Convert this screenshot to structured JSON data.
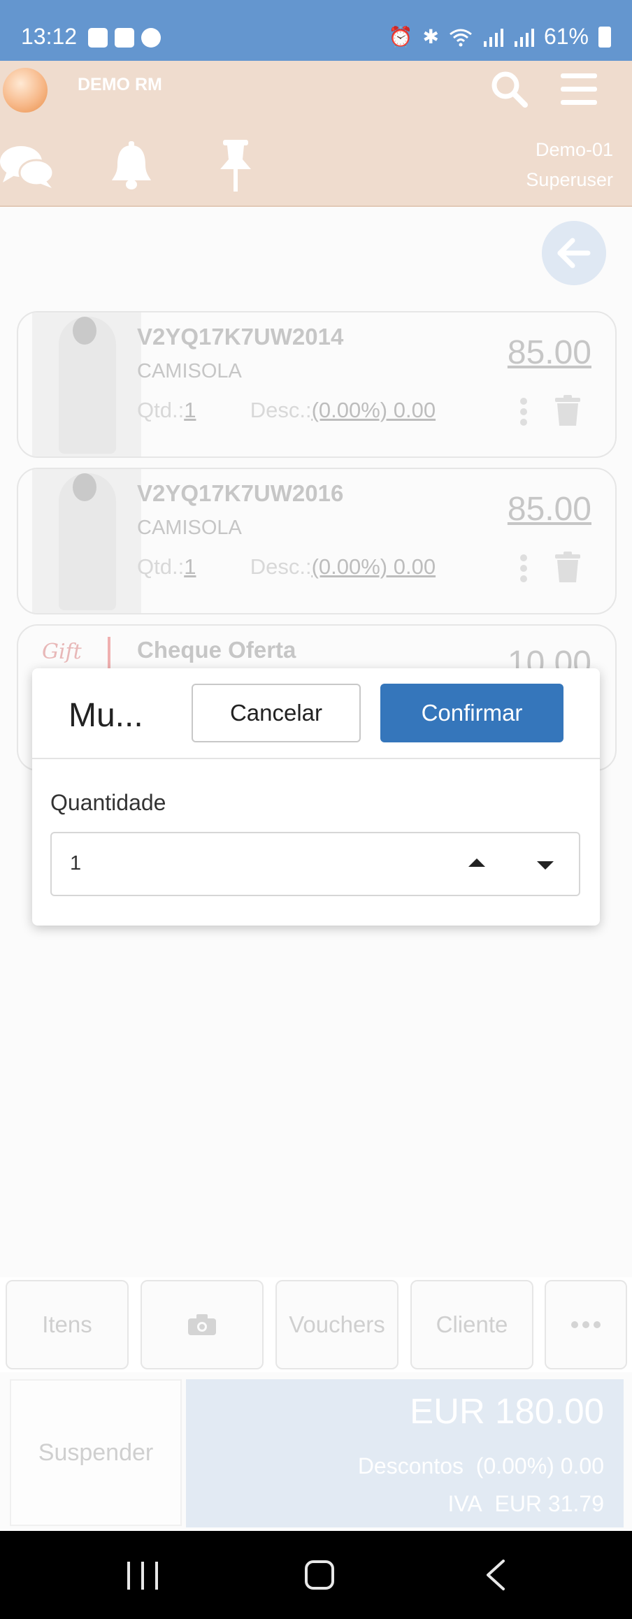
{
  "status_bar": {
    "time": "13:12",
    "battery": "61%",
    "left_icons": [
      "gallery-icon",
      "youtube-icon",
      "chrome-icon"
    ],
    "right_icons": [
      "alarm-icon",
      "bluetooth-icon",
      "wifi-icon",
      "signal-icon",
      "signal-icon",
      "battery-icon"
    ]
  },
  "header": {
    "app_name": "DEMO RM",
    "user_line1": "Demo-01",
    "user_line2": "Superuser",
    "accent_color": "#efdcce"
  },
  "items": [
    {
      "sku": "V2YQ17K7UW2014",
      "description": "CAMISOLA",
      "qty_label": "Qtd.:",
      "qty": "1",
      "disc_label": "Desc.:",
      "disc_value": "(0.00%) 0.00",
      "price": "85.00"
    },
    {
      "sku": "V2YQ17K7UW2016",
      "description": "CAMISOLA",
      "qty_label": "Qtd.:",
      "qty": "1",
      "disc_label": "Desc.:",
      "disc_value": "(0.00%) 0.00",
      "price": "85.00"
    },
    {
      "sku": "Cheque Oferta",
      "thumb_text": "Gift",
      "price": "10.00"
    }
  ],
  "modal": {
    "title": "Mu...",
    "cancel_label": "Cancelar",
    "confirm_label": "Confirmar",
    "quantity_label": "Quantidade",
    "quantity_value": "1",
    "confirm_color": "#3576bb"
  },
  "actions": {
    "items_label": "Itens",
    "vouchers_label": "Vouchers",
    "client_label": "Cliente"
  },
  "footer": {
    "suspend_label": "Suspender",
    "total": "EUR 180.00",
    "discounts_label": "Descontos",
    "discounts_value": "(0.00%) 0.00",
    "iva_label": "IVA",
    "iva_value": "EUR 31.79"
  }
}
